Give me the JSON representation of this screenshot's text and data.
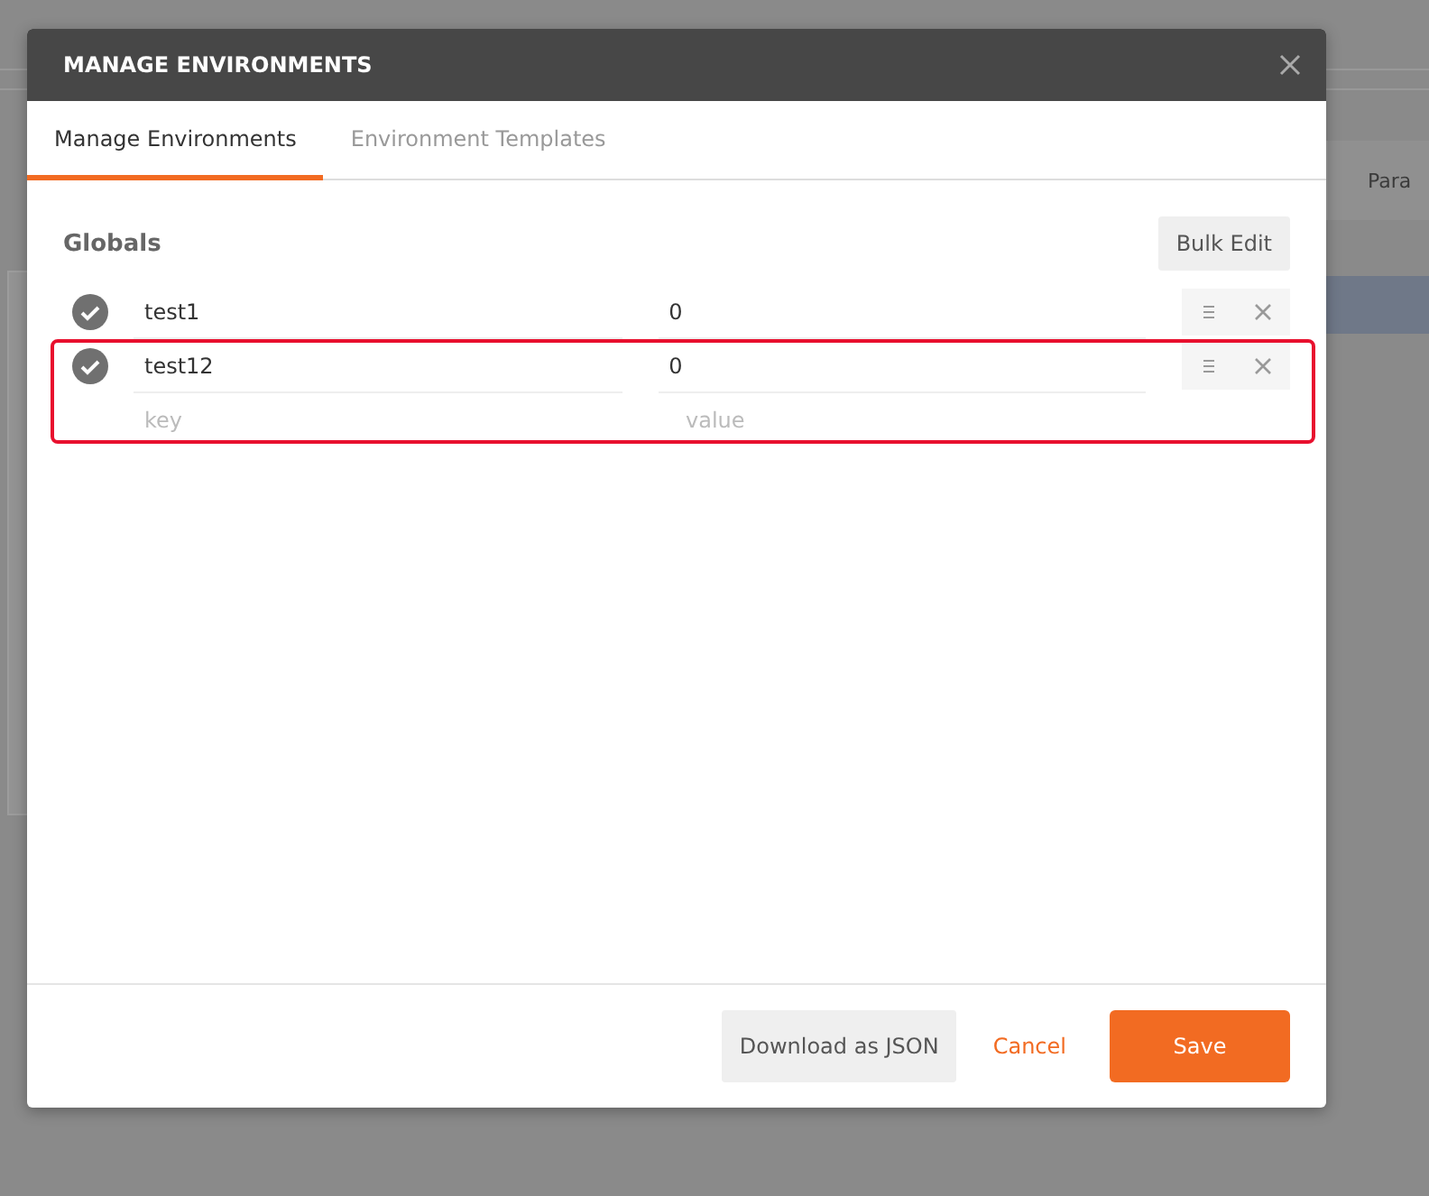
{
  "background": {
    "tab_label": "Para"
  },
  "dialog": {
    "title": "MANAGE ENVIRONMENTS",
    "tabs": [
      {
        "label": "Manage Environments",
        "selected": true
      },
      {
        "label": "Environment Templates",
        "selected": false
      }
    ],
    "section_title": "Globals",
    "bulk_edit": "Bulk Edit",
    "variables": [
      {
        "key": "test1",
        "value": "0",
        "enabled": true,
        "highlighted": false
      },
      {
        "key": "test12",
        "value": "0",
        "enabled": true,
        "highlighted": true
      }
    ],
    "new_row": {
      "key_placeholder": "key",
      "value_placeholder": "value"
    },
    "buttons": [
      {
        "label": "Download as JSON",
        "kind": "secondary"
      },
      {
        "label": "Cancel",
        "kind": "link"
      },
      {
        "label": "Save",
        "kind": "primary"
      }
    ]
  }
}
